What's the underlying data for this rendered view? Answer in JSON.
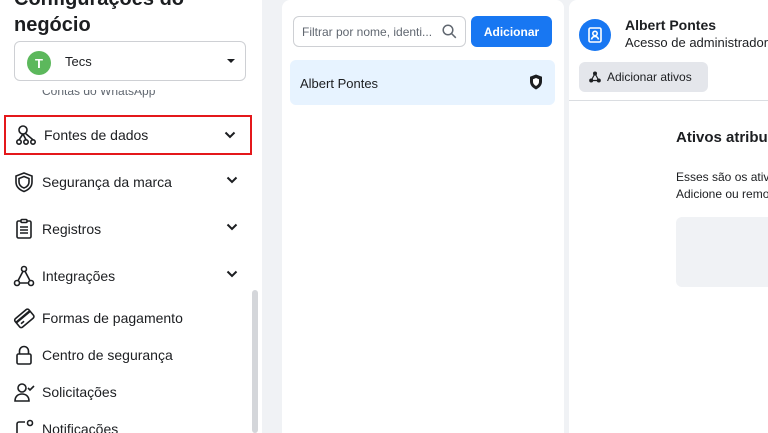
{
  "sidebar": {
    "title": "Configurações do negócio",
    "account": {
      "initial": "T",
      "name": "Tecs",
      "avatar_color": "#5cb85c"
    },
    "clipped_item": "Contas do WhatsApp",
    "items": [
      {
        "label": "Fontes de dados",
        "icon": "data-sources-icon",
        "has_caret": true,
        "highlighted": true
      },
      {
        "label": "Segurança da marca",
        "icon": "shield-icon",
        "has_caret": true
      },
      {
        "label": "Registros",
        "icon": "clipboard-icon",
        "has_caret": true
      },
      {
        "label": "Integrações",
        "icon": "integrations-icon",
        "has_caret": true
      },
      {
        "label": "Formas de pagamento",
        "icon": "credit-card-icon"
      },
      {
        "label": "Centro de segurança",
        "icon": "lock-icon"
      },
      {
        "label": "Solicitações",
        "icon": "person-check-icon"
      },
      {
        "label": "Notificações",
        "icon": "bell-icon"
      }
    ]
  },
  "people": {
    "filter_placeholder": "Filtrar por nome, identi...",
    "add_label": "Adicionar",
    "rows": [
      {
        "name": "Albert Pontes"
      }
    ]
  },
  "detail": {
    "user_name": "Albert Pontes",
    "user_role": "Acesso de administrador",
    "add_assets_label": "Adicionar ativos",
    "section_title": "Ativos atribuí",
    "section_desc_line1": "Esses são os ativ",
    "section_desc_line2": "Adicione ou remo"
  },
  "colors": {
    "accent": "#1877f2",
    "highlight_border": "#e4181b",
    "selected_row": "#e7f3ff"
  }
}
